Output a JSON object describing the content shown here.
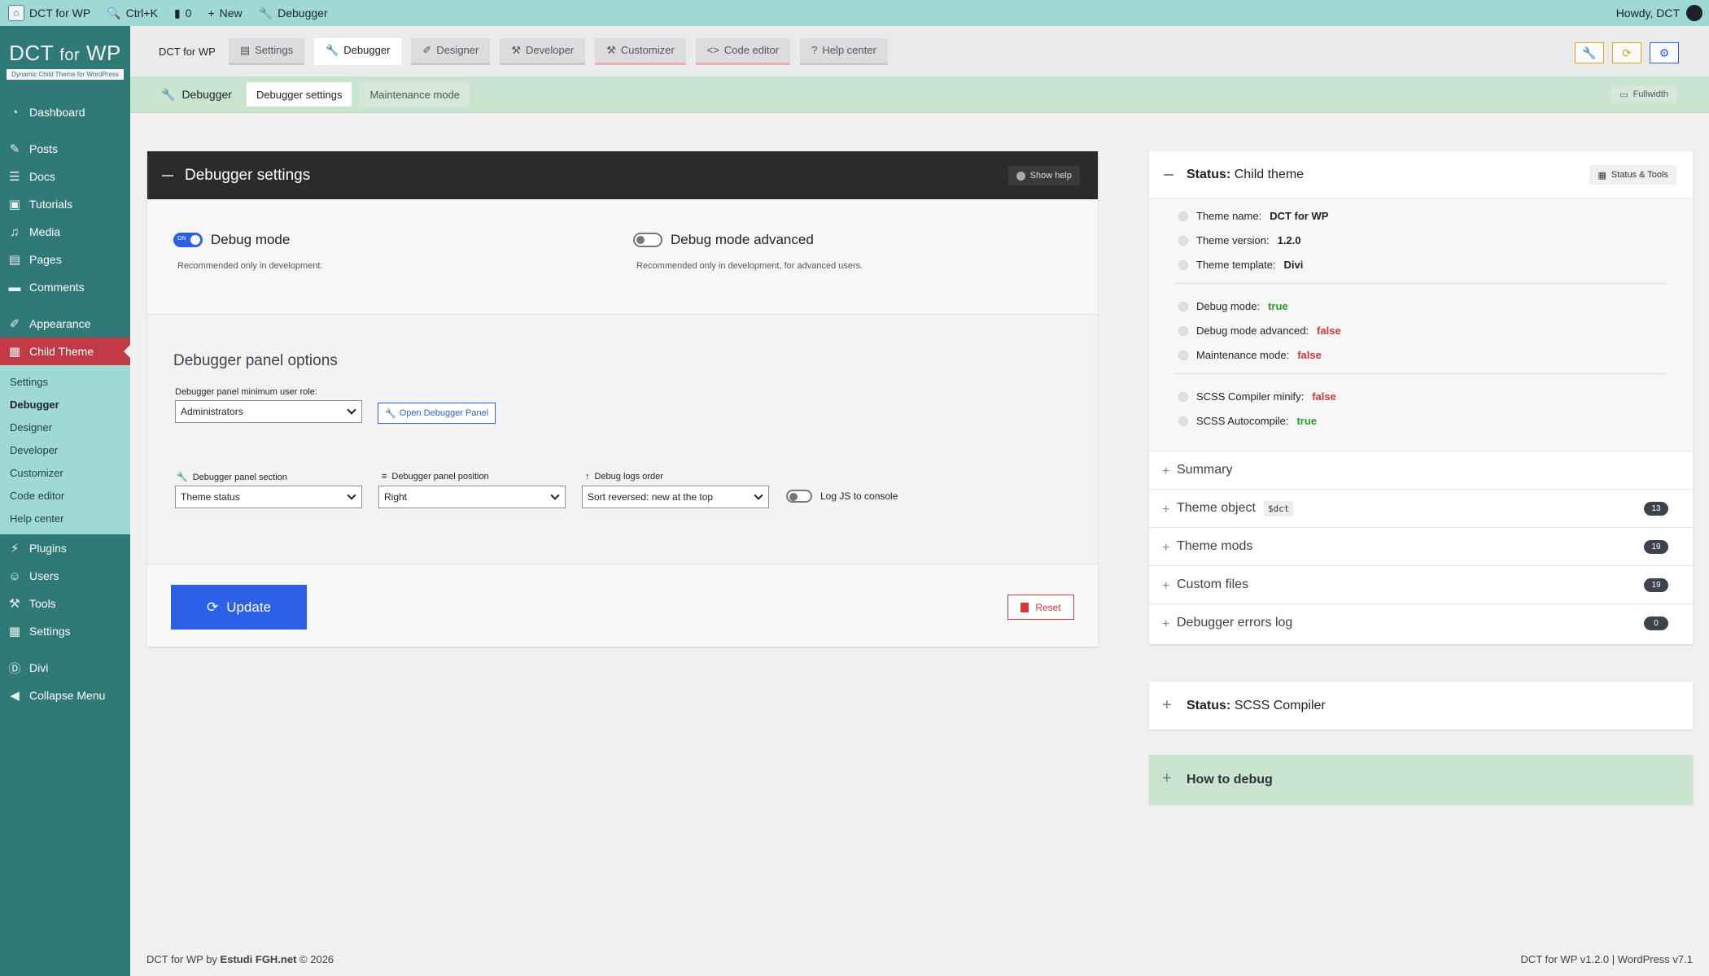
{
  "adminbar": {
    "site_name": "DCT for WP",
    "search_shortcut": "Ctrl+K",
    "comments_count": "0",
    "new_label": "New",
    "debugger_label": "Debugger",
    "howdy": "Howdy, DCT"
  },
  "brand": {
    "title_main": "DCT",
    "title_for": "for",
    "title_wp": "WP",
    "subtitle": "Dynamic Child Theme for WordPress"
  },
  "sidebar": {
    "items": [
      {
        "label": "Dashboard",
        "icon": "dashboard-icon"
      },
      {
        "label": "Posts",
        "icon": "pin-icon"
      },
      {
        "label": "Docs",
        "icon": "docs-icon"
      },
      {
        "label": "Tutorials",
        "icon": "tutorials-icon"
      },
      {
        "label": "Media",
        "icon": "media-icon"
      },
      {
        "label": "Pages",
        "icon": "pages-icon"
      },
      {
        "label": "Comments",
        "icon": "comments-icon"
      },
      {
        "label": "Appearance",
        "icon": "brush-icon"
      },
      {
        "label": "Child Theme",
        "icon": "grid-icon"
      },
      {
        "label": "Plugins",
        "icon": "plugin-icon"
      },
      {
        "label": "Users",
        "icon": "user-icon"
      },
      {
        "label": "Tools",
        "icon": "wrench-icon"
      },
      {
        "label": "Settings",
        "icon": "settings-icon"
      },
      {
        "label": "Divi",
        "icon": "divi-icon"
      },
      {
        "label": "Collapse Menu",
        "icon": "collapse-icon"
      }
    ],
    "submenu": [
      "Settings",
      "Debugger",
      "Designer",
      "Developer",
      "Customizer",
      "Code editor",
      "Help center"
    ]
  },
  "topnav": {
    "title": "DCT for WP",
    "tabs": [
      "Settings",
      "Debugger",
      "Designer",
      "Developer",
      "Customizer",
      "Code editor",
      "Help center"
    ]
  },
  "subbar": {
    "label": "Debugger",
    "tabs": [
      "Debugger settings",
      "Maintenance mode"
    ],
    "fullwidth": "Fullwidth"
  },
  "main": {
    "title": "Debugger settings",
    "show_help": "Show help",
    "debug_mode": {
      "label": "Debug mode",
      "hint": "Recommended only in development.",
      "on_text": "ON",
      "value": true
    },
    "debug_mode_advanced": {
      "label": "Debug mode advanced",
      "hint": "Recommended only in development, for advanced users.",
      "value": false
    },
    "panel_options_title": "Debugger panel options",
    "min_role_label": "Debugger panel minimum user role:",
    "min_role_value": "Administrators",
    "open_panel": "Open Debugger Panel",
    "section_label": "Debugger panel section",
    "section_value": "Theme status",
    "position_label": "Debugger panel position",
    "position_value": "Right",
    "logs_order_label": "Debug logs order",
    "logs_order_value": "Sort reversed: new at the top",
    "log_js_label": "Log JS to console",
    "log_js_value": false,
    "update": "Update",
    "reset": "Reset"
  },
  "status": {
    "title_bold": "Status:",
    "title_rest": "Child theme",
    "tools": "Status & Tools",
    "rows": [
      {
        "label": "Theme name:",
        "value": "DCT for WP"
      },
      {
        "label": "Theme version:",
        "value": "1.2.0"
      },
      {
        "label": "Theme template:",
        "value": "Divi"
      },
      {
        "label": "Debug mode:",
        "value": "true"
      },
      {
        "label": "Debug mode advanced:",
        "value": "false"
      },
      {
        "label": "Maintenance mode:",
        "value": "false"
      },
      {
        "label": "SCSS Compiler minify:",
        "value": "false"
      },
      {
        "label": "SCSS Autocompile:",
        "value": "true"
      }
    ],
    "accordions": [
      {
        "label": "Summary",
        "chip": "",
        "badge": ""
      },
      {
        "label": "Theme object",
        "chip": "$dct",
        "badge": "13"
      },
      {
        "label": "Theme mods",
        "chip": "",
        "badge": "19"
      },
      {
        "label": "Custom files",
        "chip": "",
        "badge": "19"
      },
      {
        "label": "Debugger errors log",
        "chip": "",
        "badge": "0"
      }
    ]
  },
  "scss": {
    "title_bold": "Status:",
    "title_rest": "SCSS Compiler"
  },
  "howto": {
    "title": "How to debug"
  },
  "footer": {
    "left_prefix": "DCT for WP by ",
    "left_link": "Estudi FGH.net",
    "left_suffix": " © 2026",
    "right": "DCT for WP v1.2.0 | WordPress v7.1"
  },
  "colors": {
    "accent": "#2d60e8",
    "sidebar": "#2f7a77",
    "active_menu": "#c13a46",
    "true": "#2a9a2a",
    "false": "#d63638"
  }
}
